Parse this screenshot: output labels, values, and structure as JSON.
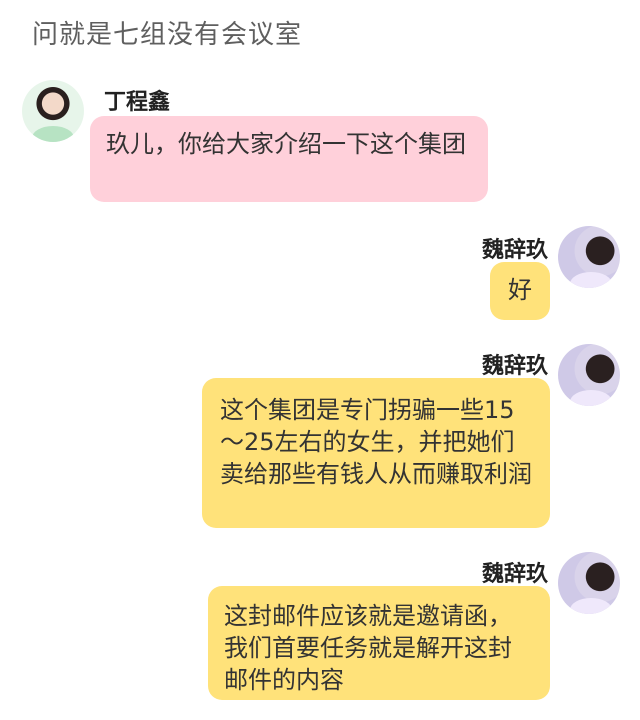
{
  "header": {
    "title": "问就是七组没有会议室"
  },
  "messages": [
    {
      "sender": "丁程鑫",
      "side": "left",
      "text": "玖儿，你给大家介绍一下这个集团",
      "bubble_color": "#ffd0da"
    },
    {
      "sender": "魏辞玖",
      "side": "right",
      "text": "好",
      "bubble_color": "#ffe27a"
    },
    {
      "sender": "魏辞玖",
      "side": "right",
      "text": "这个集团是专门拐骗一些15～25左右的女生，并把她们卖给那些有钱人从而赚取利润",
      "bubble_color": "#ffe27a"
    },
    {
      "sender": "魏辞玖",
      "side": "right",
      "text": "这封邮件应该就是邀请函，我们首要任务就是解开这封邮件的内容",
      "bubble_color": "#ffe27a"
    }
  ]
}
